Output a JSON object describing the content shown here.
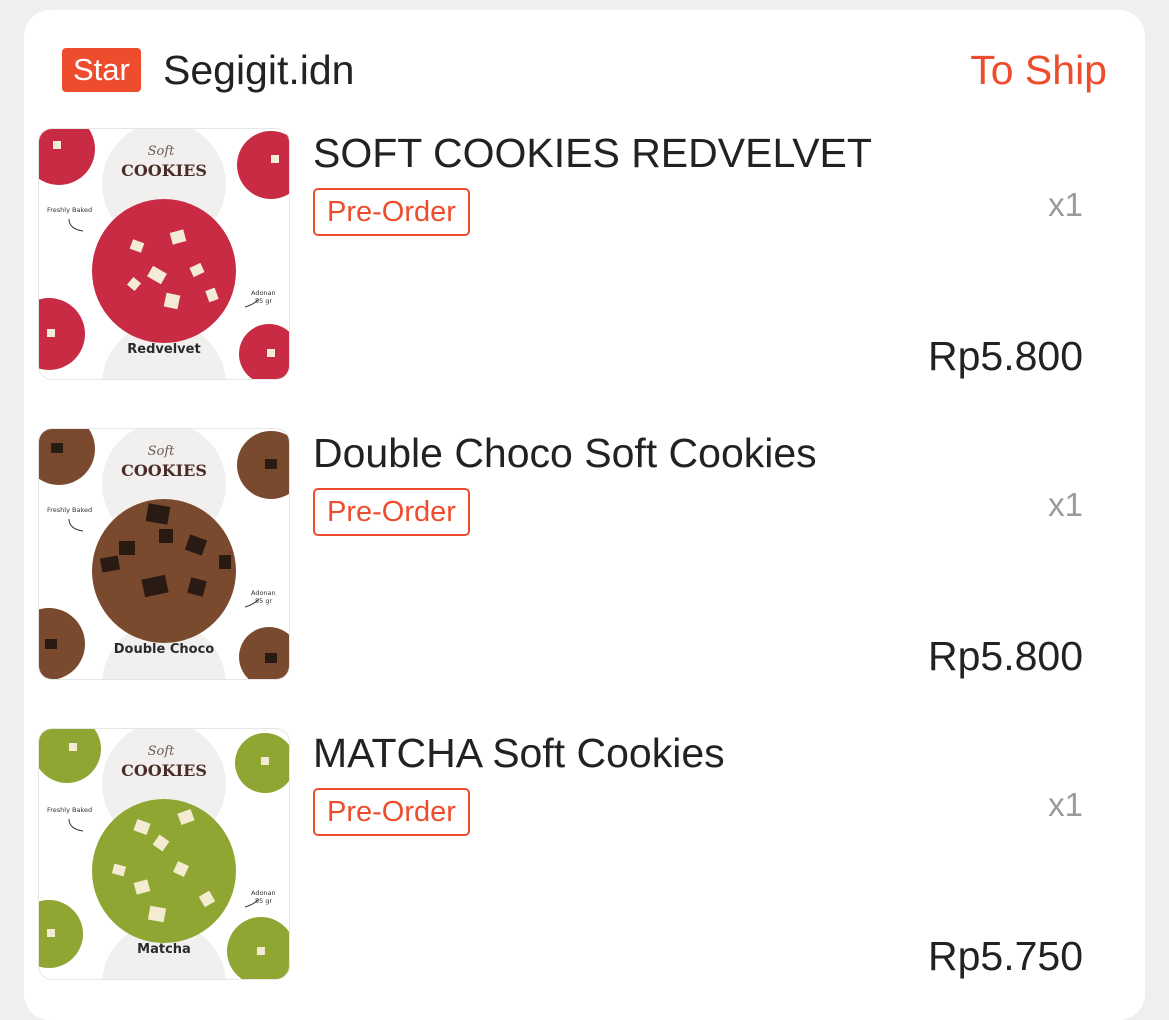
{
  "shop": {
    "badge": "Star",
    "name": "Segigit.idn",
    "status": "To Ship"
  },
  "items": [
    {
      "title": "SOFT COOKIES REDVELVET",
      "tag": "Pre-Order",
      "qty": "x1",
      "price": "Rp5.800",
      "image": {
        "script": "Soft",
        "heading": "COOKIES",
        "note1": "Freshly Baked",
        "note2a": "Adonan",
        "note2b": "55 gr",
        "flavor": "Redvelvet",
        "cookie_color": "#c92a44",
        "chunk_color": "#f4ead8"
      }
    },
    {
      "title": "Double Choco Soft Cookies",
      "tag": "Pre-Order",
      "qty": "x1",
      "price": "Rp5.800",
      "image": {
        "script": "Soft",
        "heading": "COOKIES",
        "note1": "Freshly Baked",
        "note2a": "Adonan",
        "note2b": "55 gr",
        "flavor": "Double Choco",
        "cookie_color": "#7a4a2f",
        "chunk_color": "#2a1a14"
      }
    },
    {
      "title": "MATCHA Soft Cookies",
      "tag": "Pre-Order",
      "qty": "x1",
      "price": "Rp5.750",
      "image": {
        "script": "Soft",
        "heading": "COOKIES",
        "note1": "Freshly Baked",
        "note2a": "Adonan",
        "note2b": "55 gr",
        "flavor": "Matcha",
        "cookie_color": "#8fa632",
        "chunk_color": "#f3ecd0"
      }
    }
  ]
}
